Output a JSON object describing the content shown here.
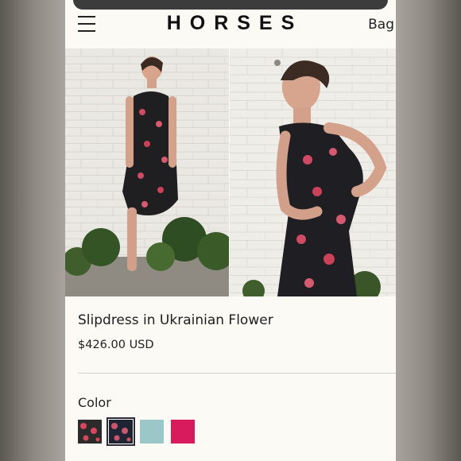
{
  "header": {
    "logo": "HORSES",
    "bag_label": "Bag"
  },
  "product": {
    "title": "Slipdress in Ukrainian Flower",
    "price": "$426.00 USD"
  },
  "options": {
    "color_label": "Color",
    "swatches": [
      {
        "name": "black-floral",
        "color": "#2b2b2b",
        "accent": "#d9455f",
        "selected": false
      },
      {
        "name": "navy-floral",
        "color": "#1e2433",
        "accent": "#c8576b",
        "selected": true
      },
      {
        "name": "light-blue",
        "color": "#9cc7c9",
        "selected": false
      },
      {
        "name": "magenta",
        "color": "#d81b5d",
        "selected": false
      }
    ]
  },
  "colors": {
    "background": "#fbfaf5",
    "text": "#1d1d1d",
    "divider": "#cfcfcf"
  }
}
